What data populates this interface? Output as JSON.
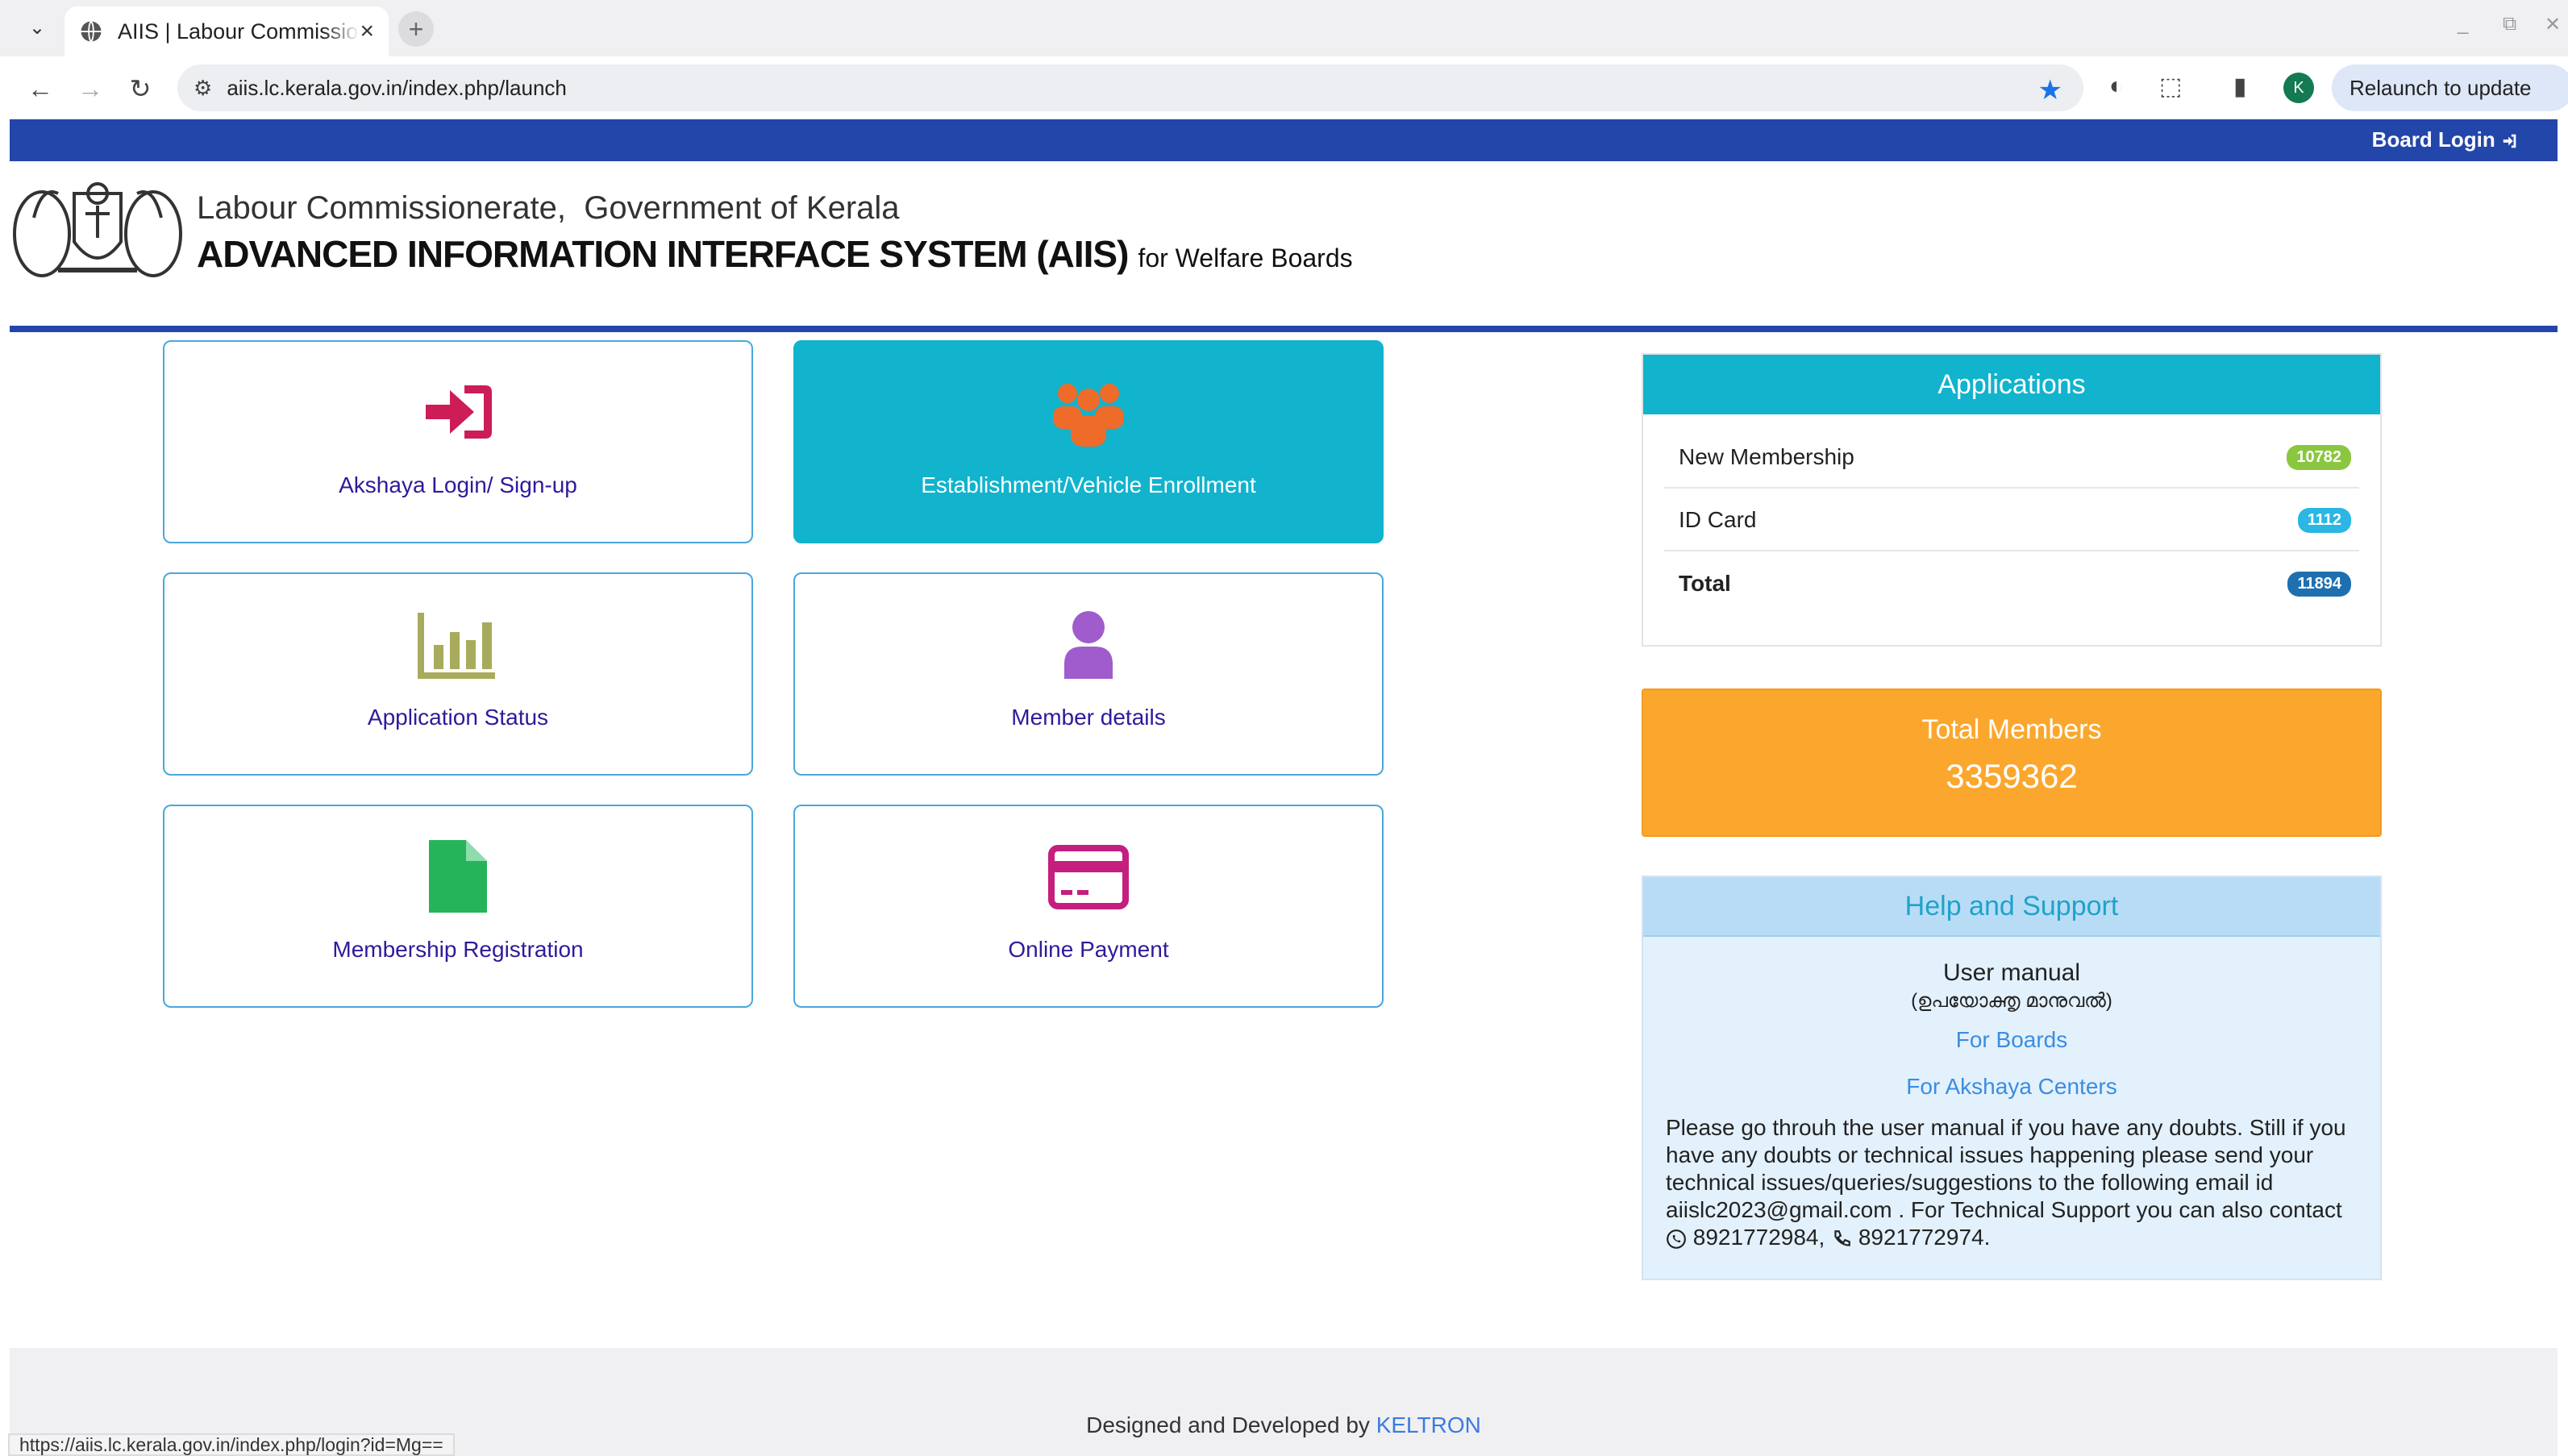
{
  "browser": {
    "tab_title": "AIIS | Labour Commissionerate",
    "url": "aiis.lc.kerala.gov.in/index.php/launch",
    "relaunch_label": "Relaunch to update",
    "profile_initial": "K",
    "status_url": "https://aiis.lc.kerala.gov.in/index.php/login?id=Mg=="
  },
  "topbar": {
    "board_login": "Board Login"
  },
  "header": {
    "line1": "Labour Commissionerate,  Government of Kerala",
    "title": "ADVANCED INFORMATION INTERFACE SYSTEM (AIIS)",
    "subtitle": "for Welfare Boards"
  },
  "tiles": [
    {
      "label": "Akshaya Login/ Sign-up",
      "icon": "sign-in-icon",
      "color": "#cc1d57"
    },
    {
      "label": "Establishment/Vehicle Enrollment",
      "icon": "group-icon",
      "color": "#ee6b2a"
    },
    {
      "label": "Application Status",
      "icon": "bar-chart-icon",
      "color": "#a8ab5c"
    },
    {
      "label": "Member details",
      "icon": "user-icon",
      "color": "#a05ccc"
    },
    {
      "label": "Membership Registration",
      "icon": "file-icon",
      "color": "#25b45a"
    },
    {
      "label": "Online Payment",
      "icon": "credit-card-icon",
      "color": "#c51e7f"
    }
  ],
  "applications": {
    "title": "Applications",
    "rows": [
      {
        "label": "New Membership",
        "count": "10782",
        "color": "#8ac640"
      },
      {
        "label": "ID Card",
        "count": "1112",
        "color": "#2bb6e3"
      },
      {
        "label": "Total",
        "count": "11894",
        "color": "#1f6fb0"
      }
    ]
  },
  "members": {
    "title": "Total Members",
    "count": "3359362"
  },
  "help": {
    "title": "Help and Support",
    "manual": "User manual",
    "manual_malayalam": "(ഉപയോക്തൃ മാനുവൽ)",
    "link_boards": "For Boards",
    "link_akshaya": "For Akshaya Centers",
    "text": "Please go throuh the user manual if you have any doubts. Still if you have any doubts or technical issues happening please send your technical issues/queries/suggestions to the following email id aiislc2023@gmail.com . For Technical Support you can also contact",
    "whatsapp": "8921772984,",
    "phone": "8921772974."
  },
  "footer": {
    "text": "Designed and Developed by",
    "link": "KELTRON"
  }
}
